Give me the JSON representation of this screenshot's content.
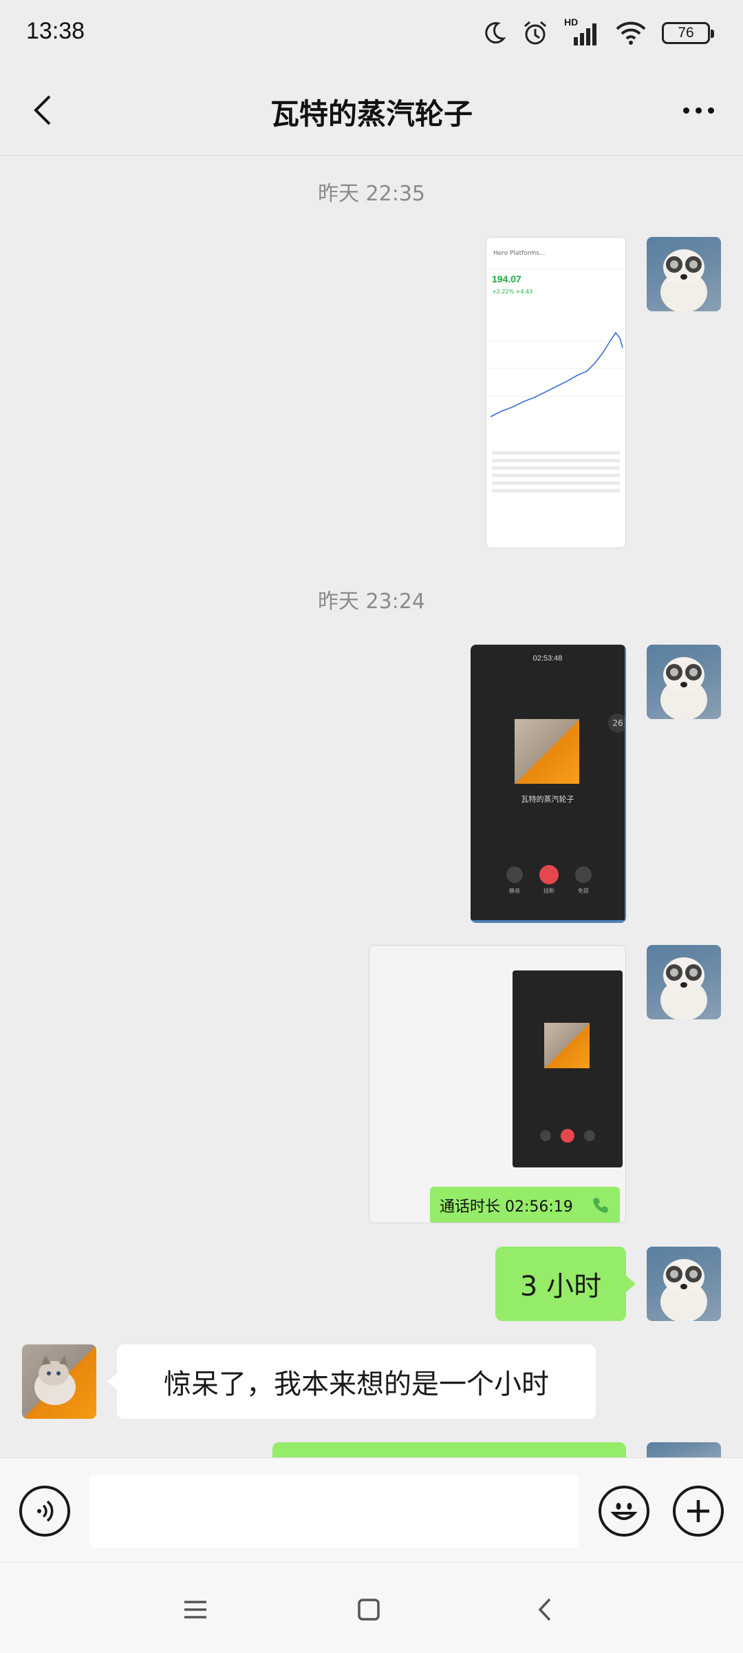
{
  "status_bar": {
    "time": "13:38",
    "battery": "76",
    "network_label": "HD",
    "icons": [
      "moon-icon",
      "alarm-icon",
      "signal-icon",
      "wifi-icon",
      "battery-icon"
    ]
  },
  "header": {
    "title": "瓦特的蒸汽轮子",
    "back_icon": "chevron-left-icon",
    "more_icon": "more-dots-icon"
  },
  "messages": [
    {
      "type": "timestamp",
      "text": "昨天 22:35"
    },
    {
      "type": "image",
      "sender": "me",
      "description_icon": "stock-chart-screenshot",
      "content": {
        "price": "194.07",
        "change": "+2.22% +4.43",
        "company": "Hero Platforms..."
      }
    },
    {
      "type": "timestamp",
      "text": "昨天 23:24"
    },
    {
      "type": "image",
      "sender": "me",
      "description_icon": "voice-call-screenshot",
      "content": {
        "timer": "02:53:48",
        "name": "瓦特的蒸汽轮子",
        "side_badge": "26",
        "buttons": [
          "静音",
          "挂断",
          "免提"
        ]
      }
    },
    {
      "type": "image",
      "sender": "me",
      "description_icon": "call-screenshot-with-duration",
      "content": {
        "call_duration": "通话时长 02:56:19"
      }
    },
    {
      "type": "text",
      "sender": "me",
      "text": "3 小时"
    },
    {
      "type": "text",
      "sender": "friend",
      "text": "惊呆了，我本来想的是一个小时"
    }
  ],
  "input_bar": {
    "placeholder": "",
    "icons": [
      "voice-icon",
      "emoji-icon",
      "plus-icon"
    ]
  },
  "colors": {
    "background": "#ededed",
    "bubble_me": "#95ec69",
    "bubble_friend": "#ffffff",
    "call_end": "#e5484d"
  }
}
